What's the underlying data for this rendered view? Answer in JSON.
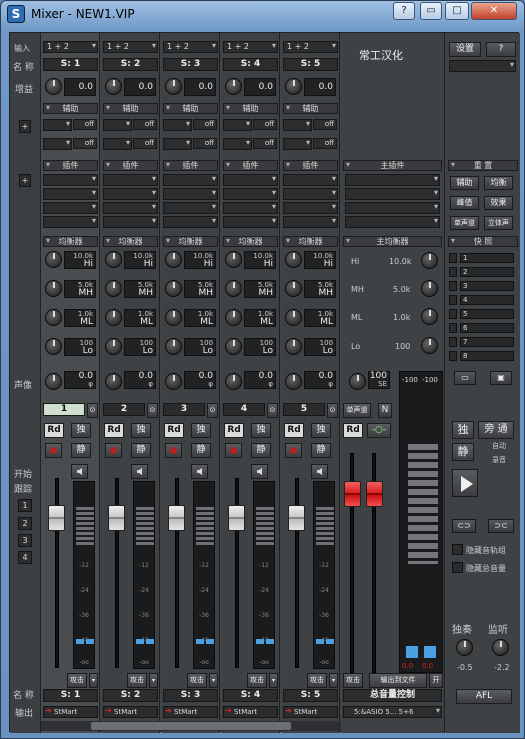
{
  "window": {
    "title": "Mixer - NEW1.VIP",
    "buttons": [
      "?",
      "▭",
      "□",
      "✕"
    ]
  },
  "sidebar": {
    "input_label": "输入",
    "name_label": "名 称",
    "gain_label": "增益",
    "pan_label": "声像",
    "start_label": "开始",
    "follow_label": "跟踪",
    "groups": [
      "1",
      "2",
      "3",
      "4"
    ],
    "bottom_name_label": "名 称",
    "output_label": "输出"
  },
  "labels": {
    "io": "1 + 2",
    "aux": "辅助",
    "insert": "插件",
    "eq": "均衡器",
    "off": "off",
    "master_insert": "主插件",
    "master_eq": "主均衡器",
    "rd": "Rd",
    "solo": "独",
    "mute": "静",
    "stmart": "StMart",
    "attack": "攻击",
    "hi": "Hi",
    "mh": "MH",
    "ml": "ML",
    "lo": "Lo",
    "phi": "φ",
    "gain_value": "0.0",
    "pan_value": "0.0"
  },
  "channels": [
    {
      "num": "1",
      "name": "S: 1"
    },
    {
      "num": "2",
      "name": "S: 2"
    },
    {
      "num": "3",
      "name": "S: 3"
    },
    {
      "num": "4",
      "name": "S: 4"
    },
    {
      "num": "5",
      "name": "S: 5"
    }
  ],
  "eq": {
    "hi": "10.0k",
    "mh": "5.0k",
    "ml": "1.0k",
    "lo": "100"
  },
  "master": {
    "credit": "常工汉化",
    "single": "单声道",
    "n": "N",
    "control": "总音量控制",
    "out_to_file": "输出到文件",
    "open": "开",
    "peak_l": "-100",
    "peak_r": "-100",
    "peak_bl": "0.0",
    "peak_br": "0.0",
    "hi": "10.0k",
    "mh": "5.0k",
    "ml": "1.0k",
    "lo": "100",
    "se_val": "100",
    "se": "SE",
    "out": "5:&ASIO 5... 5+6"
  },
  "right_panel": {
    "settings": "设置",
    "help": "?",
    "overview": "重 置",
    "aux": "辅助",
    "eq": "均衡",
    "peak": "峰值",
    "effect": "效果",
    "mono": "单声道",
    "stereo": "立体声",
    "snap_title": "快 照",
    "snaps": [
      "1",
      "2",
      "3",
      "4",
      "5",
      "6",
      "7",
      "8"
    ],
    "solo": "独",
    "bypass": "旁 通",
    "mute": "静",
    "auto": "自动",
    "record": "录音",
    "hide_bus": "隐藏音轨组",
    "hide_master": "隐藏总音量",
    "solo_knob": "独奏",
    "listen_knob": "监听",
    "solo_val": "-0.5",
    "listen_val": "-2.2",
    "afl": "AFL"
  }
}
